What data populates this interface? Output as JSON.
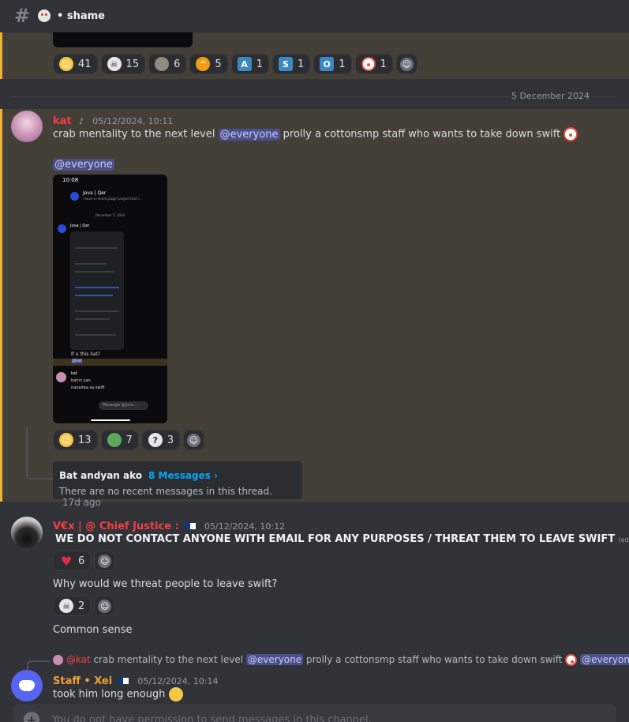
{
  "channel": {
    "name": "shame",
    "prefix": "•"
  },
  "top_reactions": [
    {
      "emoji": "grin",
      "count": "41",
      "color": "#f6c744"
    },
    {
      "emoji": "skull",
      "count": "15",
      "color": "#e6e6e6"
    },
    {
      "emoji": "rock",
      "count": "6",
      "color": "#8f8a7d"
    },
    {
      "emoji": "cat-face",
      "count": "5",
      "color": "#f39c12"
    },
    {
      "emoji": "A",
      "count": "1",
      "color": "#3b88c3"
    },
    {
      "emoji": "S",
      "count": "1",
      "color": "#3b88c3"
    },
    {
      "emoji": "O",
      "count": "1",
      "color": "#3b88c3"
    },
    {
      "emoji": "clown",
      "count": "1",
      "color": "#e74c3c"
    }
  ],
  "divider_date": "5 December 2024",
  "kat_message": {
    "author": "kat",
    "author_color": "#f23f43",
    "timestamp": "05/12/2024, 10:11",
    "text_before": "crab mentality to the next level ",
    "mention": "@everyone",
    "text_after": " prolly a cottonsmp staff who wants to take down swift",
    "line2_mention": "@everyone",
    "reactions": [
      {
        "emoji": "joy",
        "count": "13",
        "color": "#f6c744"
      },
      {
        "emoji": "pepe",
        "count": "7",
        "color": "#5aa55a"
      },
      {
        "emoji": "skull-question",
        "count": "3",
        "color": "#e6e6e6"
      }
    ],
    "screenshot": {
      "time": "10:08",
      "chat_name": "Jova | Qer",
      "subtitle": "I have a recent plugin project that I...",
      "date_label": "December 5, 2024",
      "sender": "Jova | Qer",
      "question": "If u this kat?",
      "mention_tag": "@kat",
      "reply_name": "kat",
      "reply_line1": "bahin yan",
      "reply_line2": "nanalrea sa swift",
      "input_placeholder": "Message @Jova..."
    }
  },
  "thread": {
    "name": "Bat andyan ako",
    "link": "8 Messages ›",
    "note": "There are no recent messages in this thread.",
    "age": "17d ago"
  },
  "vex_message": {
    "author": "V€x | @ Chief Justice :",
    "author_color": "#f23f43",
    "timestamp": "05/12/2024, 10:12",
    "text1": "WE DO NOT CONTACT ANYONE WITH EMAIL FOR ANY PURPOSES / THREAT THEM TO LEAVE SWIFT",
    "edited": "(edited)",
    "reaction1": {
      "emoji": "heart",
      "count": "6",
      "color": "#dd2e44"
    },
    "text2": "Why would we threat people to leave swift?",
    "reaction2": {
      "emoji": "skull",
      "count": "2",
      "color": "#e6e6e6"
    },
    "text3": "Common sense"
  },
  "reply_preview": {
    "author": "@kat",
    "text_before": " crab mentality to the next level ",
    "mention1": "@everyone",
    "text_after": " prolly a cottonsmp staff who wants to take down swift ",
    "mention2": "@everyone"
  },
  "staff_message": {
    "author": "Staff • Xei",
    "author_color": "#f0a232",
    "timestamp": "05/12/2024, 10:14",
    "text": "took him long enough"
  },
  "composer": {
    "placeholder": "You do not have permission to send messages in this channel."
  }
}
